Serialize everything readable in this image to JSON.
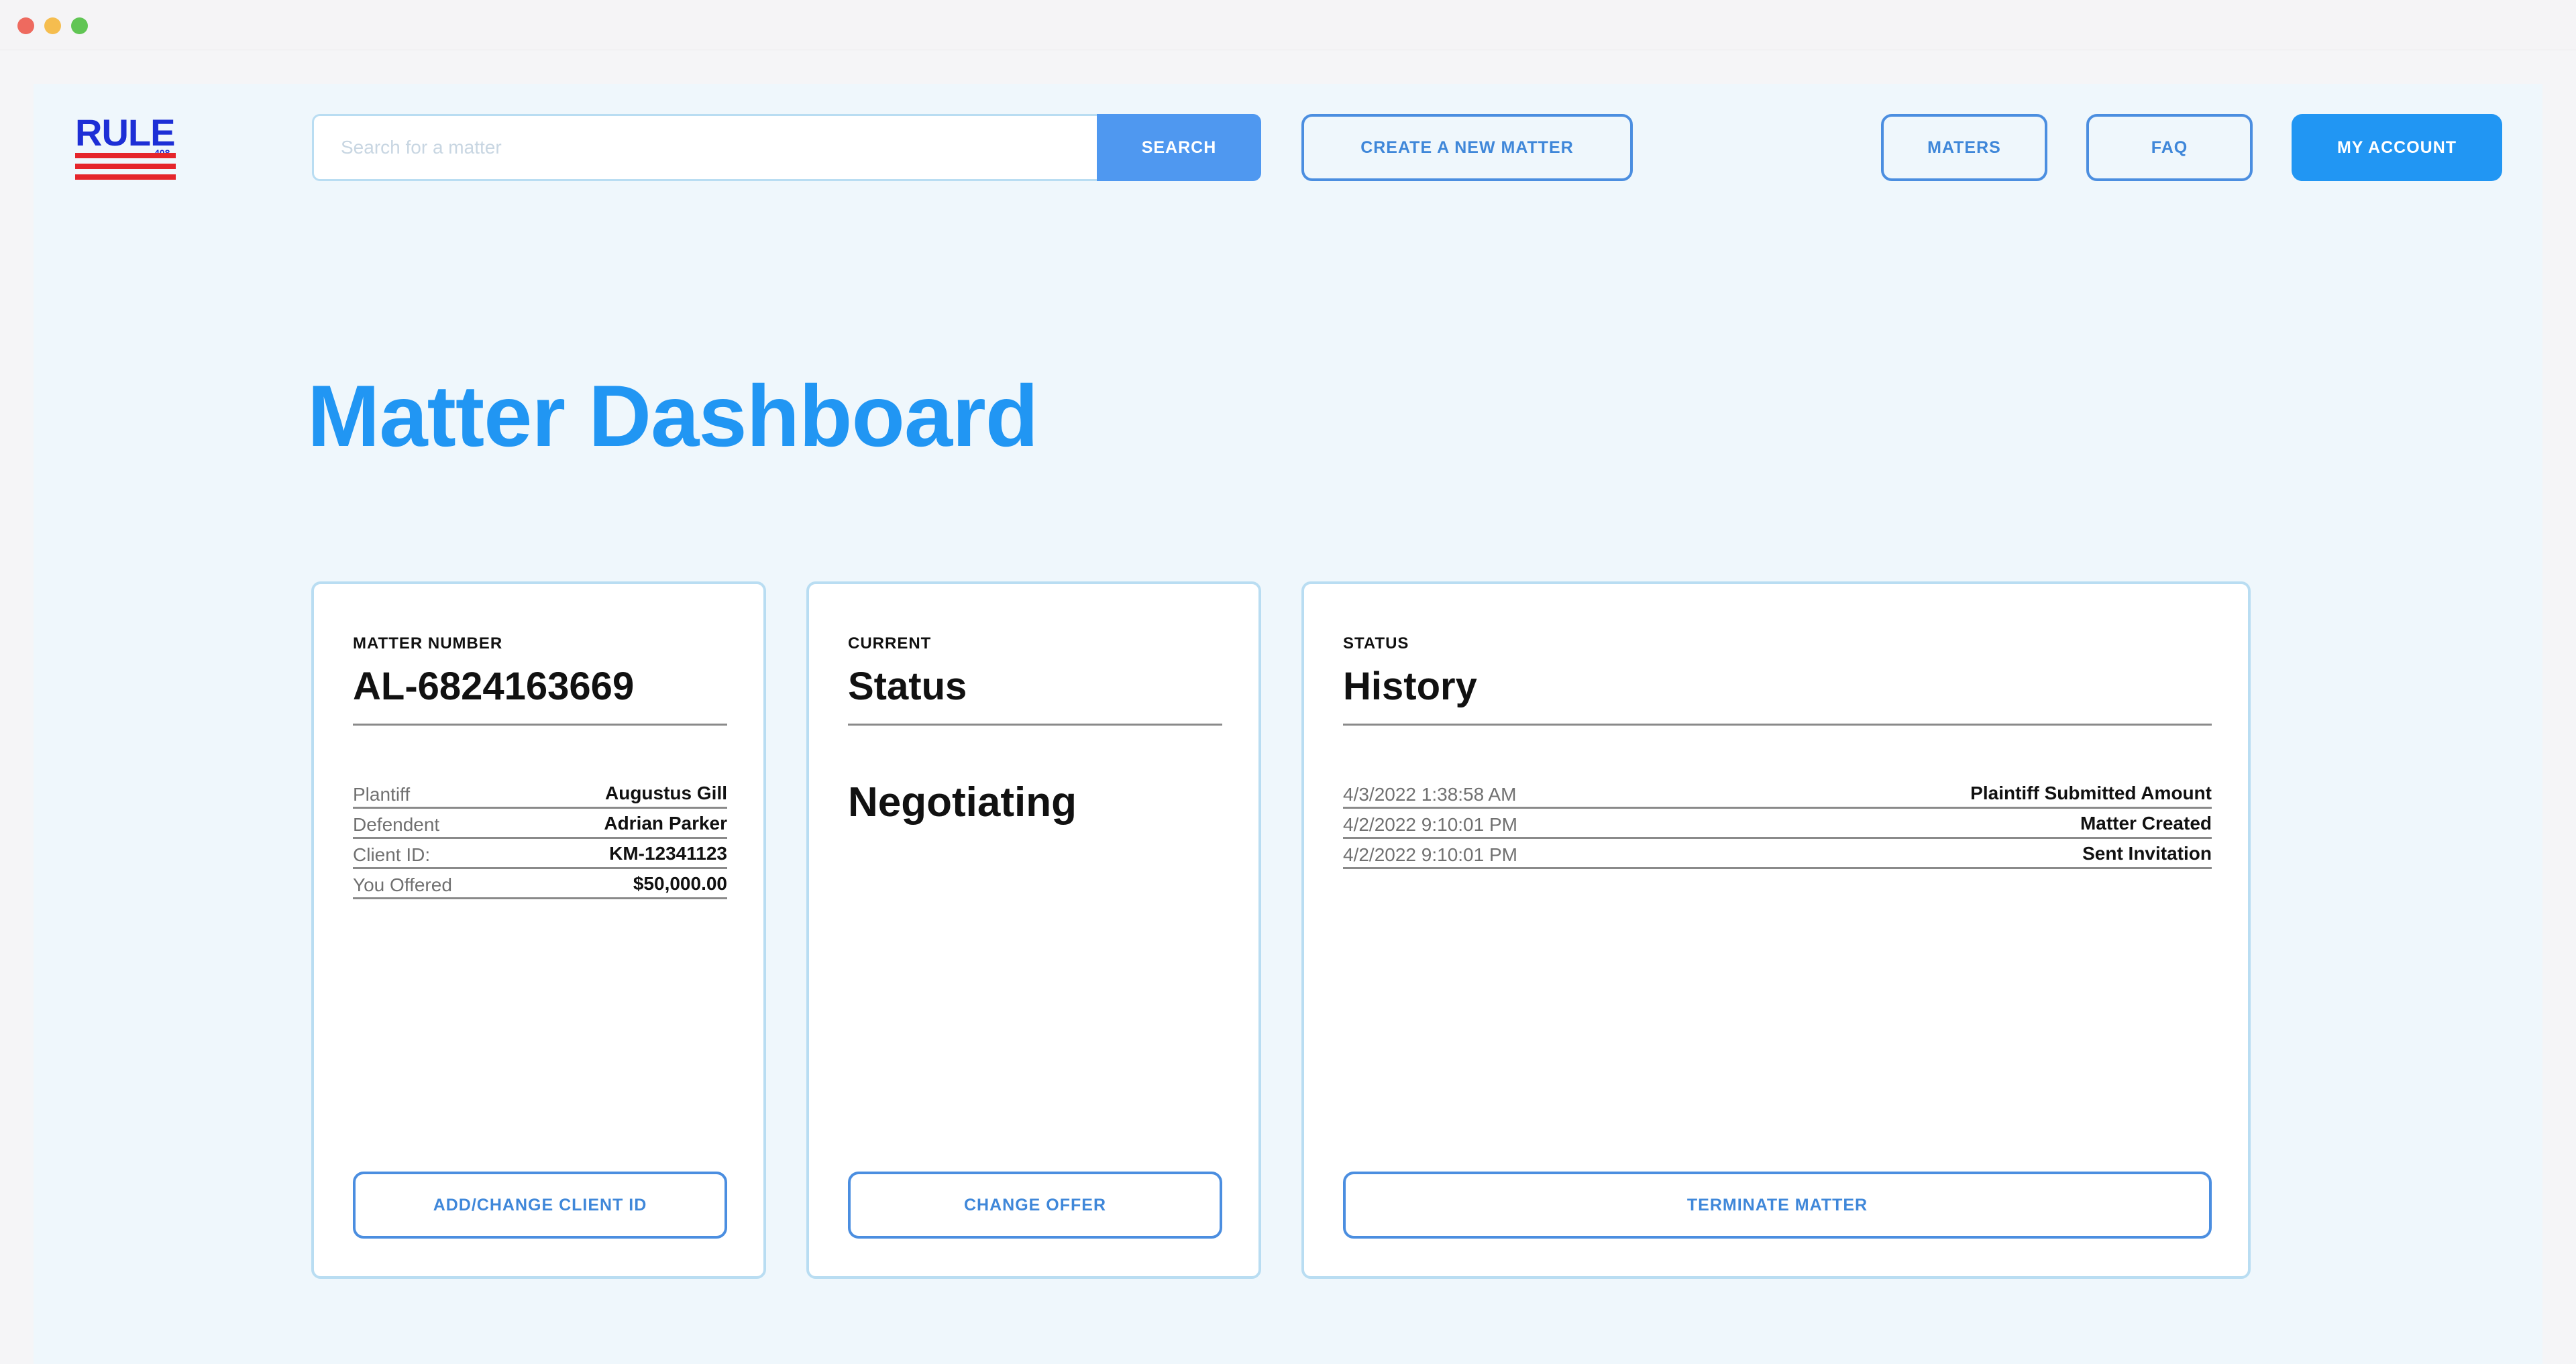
{
  "colors": {
    "accent": "#2196f3",
    "button_outline": "#4b8ee0",
    "card_border": "#b9ddf2",
    "background": "#eff7fc",
    "logo_blue": "#1d2fd6",
    "logo_red": "#e5252b"
  },
  "logo": {
    "text": "RULE",
    "number": "408"
  },
  "search": {
    "placeholder": "Search for a matter",
    "value": "",
    "button_label": "SEARCH"
  },
  "header": {
    "create_matter_label": "CREATE A NEW MATTER",
    "nav": {
      "maters": "MATERS",
      "faq": "FAQ",
      "my_account": "MY ACCOUNT"
    }
  },
  "page": {
    "title": "Matter Dashboard"
  },
  "matter_card": {
    "eyebrow": "MATTER NUMBER",
    "number": "AL-6824163669",
    "details": [
      {
        "label": "Plantiff",
        "value": "Augustus Gill"
      },
      {
        "label": "Defendent",
        "value": "Adrian Parker"
      },
      {
        "label": "Client ID:",
        "value": "KM-12341123"
      },
      {
        "label": "You Offered",
        "value": "$50,000.00"
      }
    ],
    "button_label": "ADD/CHANGE CLIENT ID"
  },
  "status_card": {
    "eyebrow": "CURRENT",
    "heading": "Status",
    "value": "Negotiating",
    "button_label": "CHANGE OFFER"
  },
  "history_card": {
    "eyebrow": "STATUS",
    "heading": "History",
    "entries": [
      {
        "timestamp": "4/3/2022 1:38:58 AM",
        "event": "Plaintiff Submitted Amount"
      },
      {
        "timestamp": "4/2/2022 9:10:01 PM",
        "event": "Matter Created"
      },
      {
        "timestamp": "4/2/2022 9:10:01 PM",
        "event": "Sent Invitation"
      }
    ],
    "button_label": "TERMINATE MATTER"
  }
}
